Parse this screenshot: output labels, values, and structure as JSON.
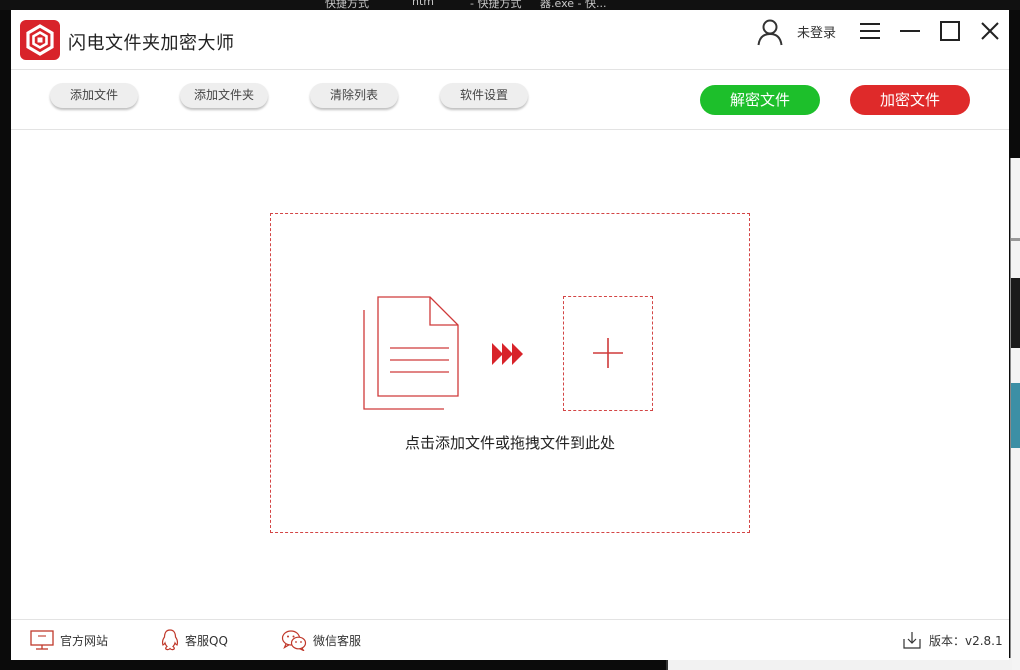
{
  "desktop": {
    "top_fragments": [
      "快捷方式",
      "htm",
      "- 快捷方式",
      "器.exe - 快..."
    ]
  },
  "window": {
    "title": "闪电文件夹加密大师",
    "user": {
      "login_label": "未登录"
    }
  },
  "toolbar": {
    "buttons": [
      {
        "label": "添加文件"
      },
      {
        "label": "添加文件夹"
      },
      {
        "label": "清除列表"
      },
      {
        "label": "软件设置"
      }
    ],
    "decrypt_label": "解密文件",
    "encrypt_label": "加密文件"
  },
  "dropzone": {
    "hint": "点击添加文件或拖拽文件到此处"
  },
  "statusbar": {
    "website_label": "官方网站",
    "qq_label": "客服QQ",
    "wechat_label": "微信客服",
    "version_label": "版本：v2.8.1"
  },
  "colors": {
    "brand_red": "#d8232a",
    "decrypt_green": "#1dbf2b",
    "encrypt_red": "#df2a2a",
    "dashed_border": "#d34545"
  },
  "icons": [
    "app-logo-icon",
    "user-icon",
    "menu-icon",
    "minimize-icon",
    "maximize-icon",
    "close-icon",
    "document-icon",
    "triple-arrow-icon",
    "plus-icon",
    "monitor-icon",
    "qq-penguin-icon",
    "wechat-icon",
    "download-icon"
  ]
}
